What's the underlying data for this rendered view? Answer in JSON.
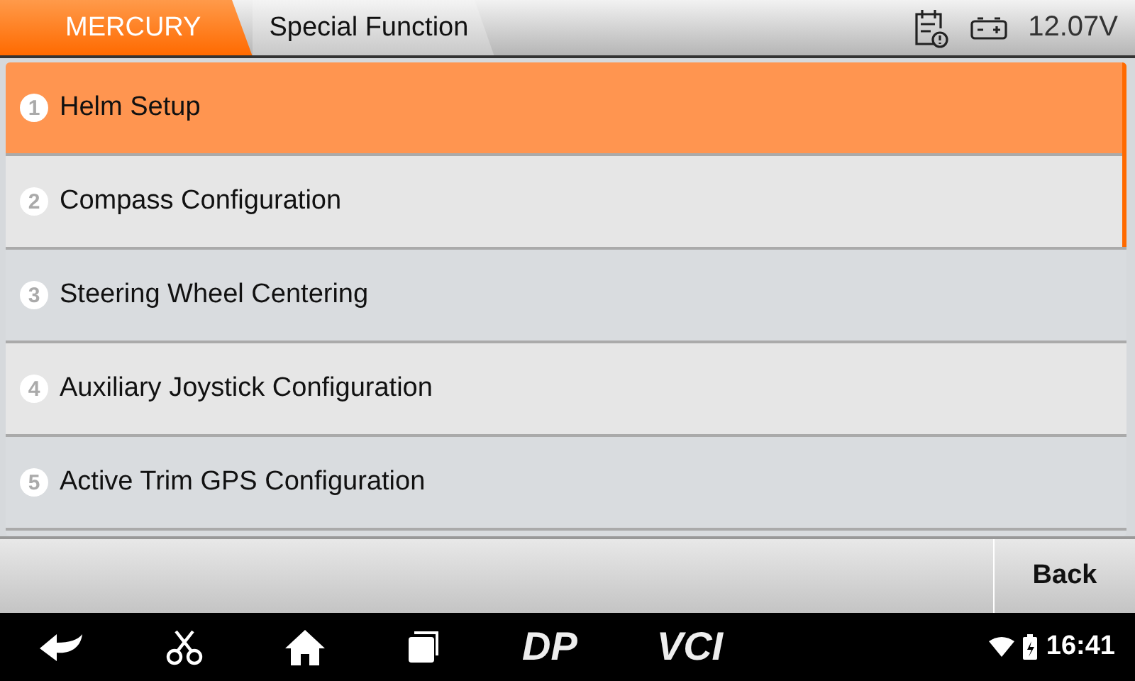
{
  "breadcrumbs": [
    {
      "label": "MERCURY",
      "selected": true
    },
    {
      "label": "Special Function",
      "selected": false
    }
  ],
  "status": {
    "voltage": "12.07V"
  },
  "menu": [
    {
      "number": "1",
      "label": "Helm Setup",
      "selected": true
    },
    {
      "number": "2",
      "label": "Compass Configuration",
      "selected": false
    },
    {
      "number": "3",
      "label": "Steering Wheel Centering",
      "selected": false
    },
    {
      "number": "4",
      "label": "Auxiliary Joystick Configuration",
      "selected": false
    },
    {
      "number": "5",
      "label": "Active Trim GPS Configuration",
      "selected": false
    }
  ],
  "buttons": [
    "Back"
  ],
  "navbar": {
    "dp": "DP",
    "vci": "VCI",
    "time": "16:41"
  }
}
